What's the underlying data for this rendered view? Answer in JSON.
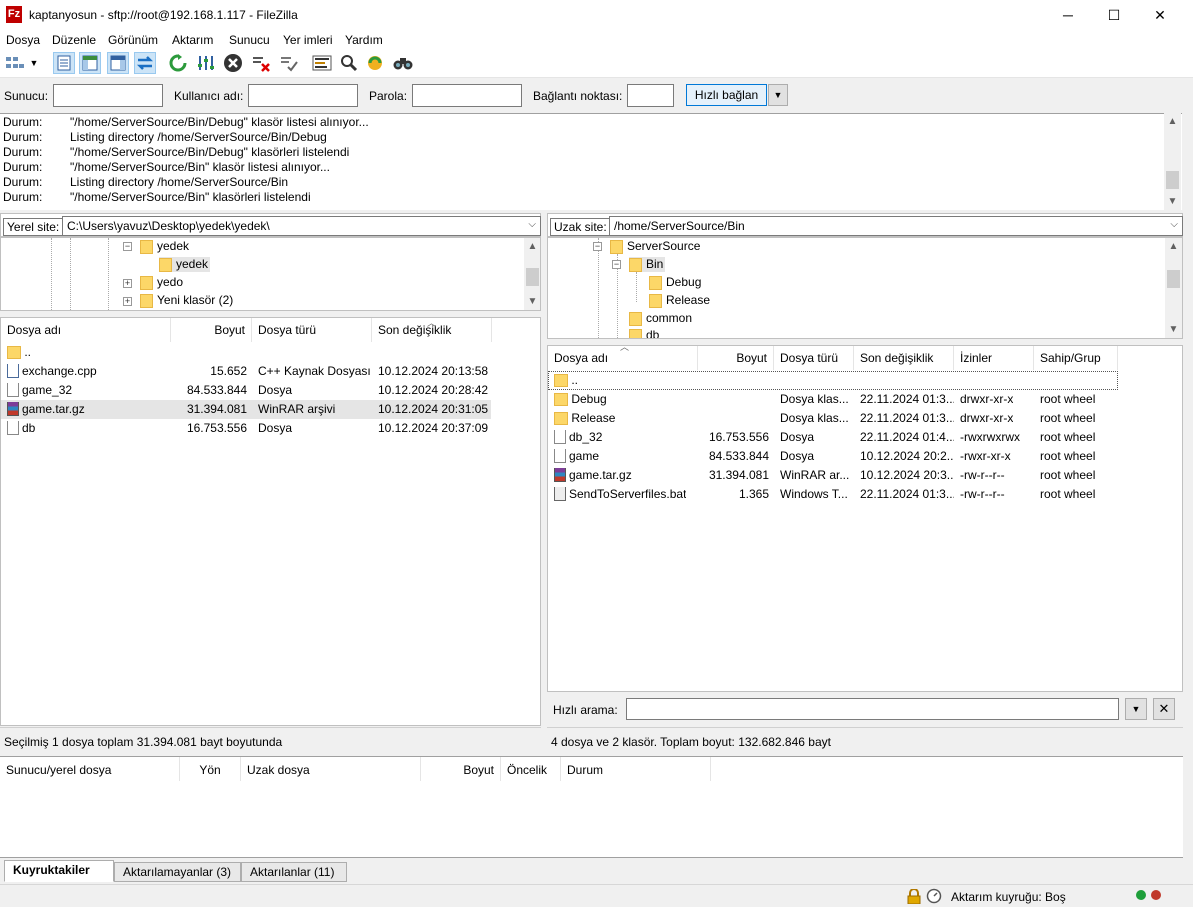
{
  "window": {
    "title": "kaptanyosun - sftp://root@192.168.1.117 - FileZilla",
    "minimize_glyph": "─",
    "maximize_glyph": "☐",
    "close_glyph": "✕"
  },
  "menu": {
    "items": [
      "Dosya",
      "Düzenle",
      "Görünüm",
      "Aktarım",
      "Sunucu",
      "Yer imleri",
      "Yardım"
    ]
  },
  "toolbar": {
    "icons": [
      "site-manager-icon",
      "dropdown-arrow-icon",
      "toggle-log-icon",
      "toggle-local-tree-icon",
      "toggle-remote-tree-icon",
      "toggle-queue-icon",
      "refresh-icon",
      "process-queue-icon",
      "cancel-icon",
      "disconnect-icon",
      "reconnect-icon",
      "directory-filter-icon",
      "search-icon",
      "compare-icon",
      "find-files-icon"
    ]
  },
  "quickconnect": {
    "host_label": "Sunucu:",
    "user_label": "Kullanıcı adı:",
    "password_label": "Parola:",
    "port_label": "Bağlantı noktası:",
    "host_value": "",
    "user_value": "",
    "password_value": "",
    "port_value": "",
    "button_label": "Hızlı bağlan",
    "dropdown_glyph": "▼"
  },
  "log": {
    "rows": [
      {
        "label": "Durum:",
        "text": "\"/home/ServerSource/Bin/Debug\" klasör listesi alınıyor..."
      },
      {
        "label": "Durum:",
        "text": "Listing directory /home/ServerSource/Bin/Debug"
      },
      {
        "label": "Durum:",
        "text": "\"/home/ServerSource/Bin/Debug\" klasörleri listelendi"
      },
      {
        "label": "Durum:",
        "text": "\"/home/ServerSource/Bin\" klasör listesi alınıyor..."
      },
      {
        "label": "Durum:",
        "text": "Listing directory /home/ServerSource/Bin"
      },
      {
        "label": "Durum:",
        "text": "\"/home/ServerSource/Bin\" klasörleri listelendi"
      }
    ]
  },
  "local": {
    "site_label": "Yerel site:",
    "path": "C:\\Users\\yavuz\\Desktop\\yedek\\yedek\\",
    "tree": [
      {
        "name": "yedek",
        "expander": "−"
      },
      {
        "name": "yedek",
        "expander": ""
      },
      {
        "name": "yedo",
        "expander": "+"
      },
      {
        "name": "Yeni klasör (2)",
        "expander": "+"
      }
    ],
    "columns": {
      "name": "Dosya adı",
      "size": "Boyut",
      "type": "Dosya türü",
      "modified": "Son değişiklik"
    },
    "files": [
      {
        "name": "..",
        "size": "",
        "type": "",
        "modified": ""
      },
      {
        "name": "exchange.cpp",
        "size": "15.652",
        "type": "C++ Kaynak Dosyası",
        "modified": "10.12.2024 20:13:58"
      },
      {
        "name": "game_32",
        "size": "84.533.844",
        "type": "Dosya",
        "modified": "10.12.2024 20:28:42"
      },
      {
        "name": "game.tar.gz",
        "size": "31.394.081",
        "type": "WinRAR arşivi",
        "modified": "10.12.2024 20:31:05"
      },
      {
        "name": "db",
        "size": "16.753.556",
        "type": "Dosya",
        "modified": "10.12.2024 20:37:09"
      }
    ],
    "status": "Seçilmiş 1 dosya toplam 31.394.081 bayt boyutunda"
  },
  "remote": {
    "site_label": "Uzak site:",
    "path": "/home/ServerSource/Bin",
    "tree": [
      {
        "name": "ServerSource",
        "expander": "−"
      },
      {
        "name": "Bin",
        "expander": "−"
      },
      {
        "name": "Debug",
        "expander": ""
      },
      {
        "name": "Release",
        "expander": ""
      },
      {
        "name": "common",
        "expander": ""
      },
      {
        "name": "db",
        "expander": ""
      }
    ],
    "columns": {
      "name": "Dosya adı",
      "size": "Boyut",
      "type": "Dosya türü",
      "modified": "Son değişiklik",
      "perms": "İzinler",
      "owner": "Sahip/Grup"
    },
    "files": [
      {
        "name": "..",
        "size": "",
        "type": "",
        "modified": "",
        "perms": "",
        "owner": ""
      },
      {
        "name": "Debug",
        "size": "",
        "type": "Dosya klas...",
        "modified": "22.11.2024 01:3...",
        "perms": "drwxr-xr-x",
        "owner": "root wheel"
      },
      {
        "name": "Release",
        "size": "",
        "type": "Dosya klas...",
        "modified": "22.11.2024 01:3...",
        "perms": "drwxr-xr-x",
        "owner": "root wheel"
      },
      {
        "name": "db_32",
        "size": "16.753.556",
        "type": "Dosya",
        "modified": "22.11.2024 01:4...",
        "perms": "-rwxrwxrwx",
        "owner": "root wheel"
      },
      {
        "name": "game",
        "size": "84.533.844",
        "type": "Dosya",
        "modified": "10.12.2024 20:2...",
        "perms": "-rwxr-xr-x",
        "owner": "root wheel"
      },
      {
        "name": "game.tar.gz",
        "size": "31.394.081",
        "type": "WinRAR ar...",
        "modified": "10.12.2024 20:3...",
        "perms": "-rw-r--r--",
        "owner": "root wheel"
      },
      {
        "name": "SendToServerfiles.bat",
        "size": "1.365",
        "type": "Windows T...",
        "modified": "22.11.2024 01:3...",
        "perms": "-rw-r--r--",
        "owner": "root wheel"
      }
    ],
    "search_label": "Hızlı arama:",
    "search_value": "",
    "status": "4 dosya ve 2 klasör. Toplam boyut: 132.682.846 bayt"
  },
  "queue": {
    "columns": [
      "Sunucu/yerel dosya",
      "Yön",
      "Uzak dosya",
      "Boyut",
      "Öncelik",
      "Durum"
    ]
  },
  "tabs": [
    {
      "label": "Kuyruktakiler",
      "active": true
    },
    {
      "label": "Aktarılamayanlar (3)",
      "active": false
    },
    {
      "label": "Aktarılanlar (11)",
      "active": false
    }
  ],
  "statusbar": {
    "queue_text": "Aktarım kuyruğu: Boş"
  },
  "colors": {
    "accent": "#0078d7",
    "folder": "#fcd768",
    "selection": "#e5e5e5",
    "led_green": "#1e9e3a",
    "led_red": "#c0392b"
  }
}
